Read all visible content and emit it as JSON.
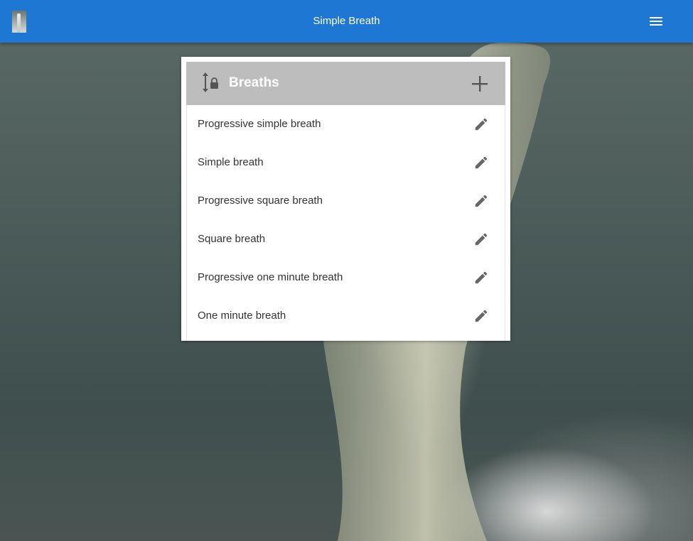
{
  "app_bar": {
    "title": "Simple Breath",
    "logo_icon": "tornado-photo-icon",
    "menu_icon": "hamburger-menu-icon",
    "color": "#1e78d3"
  },
  "breaths_card": {
    "header": {
      "title": "Breaths",
      "reorder_icon": "reorder-lock-icon",
      "add_icon": "plus-icon",
      "background": "#bdbdbd"
    },
    "items": [
      {
        "label": "Progressive simple breath",
        "action_icon": "pencil-icon"
      },
      {
        "label": "Simple breath",
        "action_icon": "pencil-icon"
      },
      {
        "label": "Progressive square breath",
        "action_icon": "pencil-icon"
      },
      {
        "label": "Square breath",
        "action_icon": "pencil-icon"
      },
      {
        "label": "Progressive one minute breath",
        "action_icon": "pencil-icon"
      },
      {
        "label": "One minute breath",
        "action_icon": "pencil-icon"
      }
    ]
  }
}
